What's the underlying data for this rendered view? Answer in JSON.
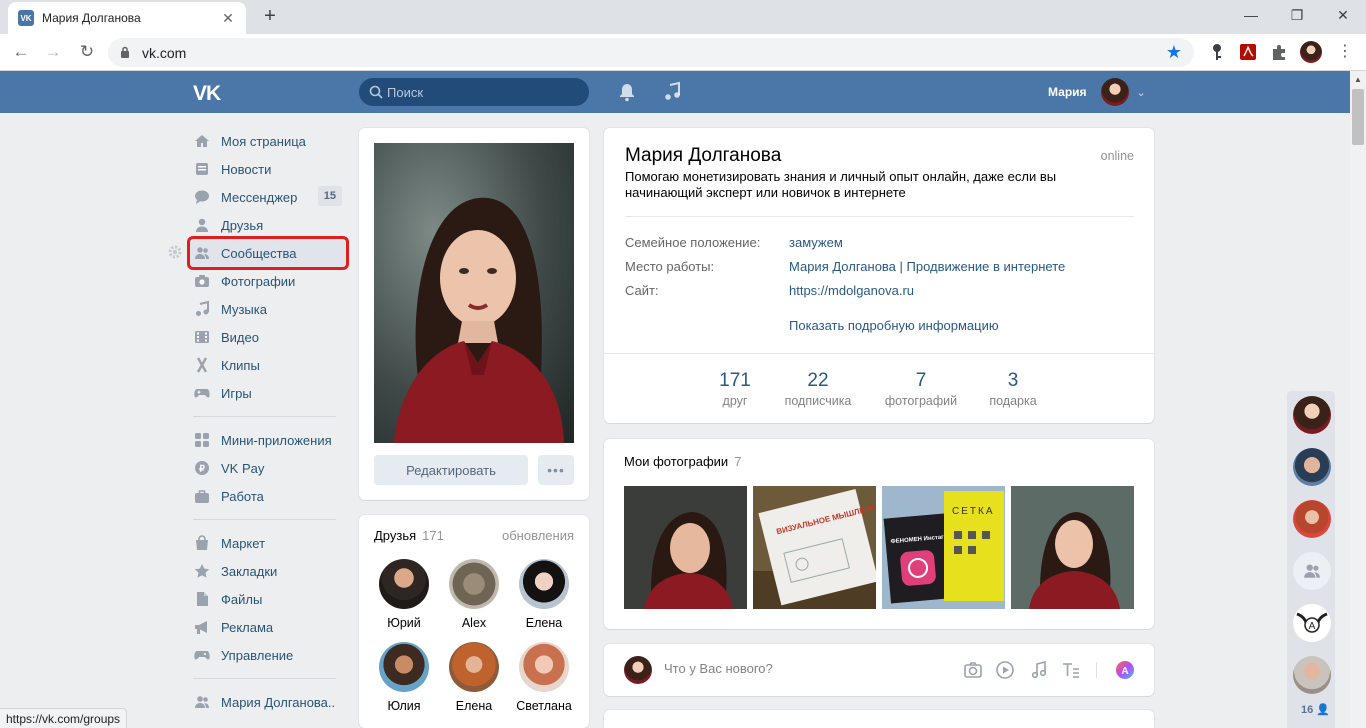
{
  "browser": {
    "tab_title": "Мария Долганова",
    "url": "vk.com",
    "status_url": "https://vk.com/groups"
  },
  "header": {
    "logo": "VK",
    "search_placeholder": "Поиск",
    "user_name": "Мария"
  },
  "menu": {
    "items": [
      {
        "label": "Моя страница",
        "icon": "home-icon"
      },
      {
        "label": "Новости",
        "icon": "news-icon"
      },
      {
        "label": "Мессенджер",
        "icon": "messenger-icon",
        "count": "15"
      },
      {
        "label": "Друзья",
        "icon": "friends-icon"
      },
      {
        "label": "Сообщества",
        "icon": "communities-icon"
      },
      {
        "label": "Фотографии",
        "icon": "photos-icon"
      },
      {
        "label": "Музыка",
        "icon": "music-icon"
      },
      {
        "label": "Видео",
        "icon": "video-icon"
      },
      {
        "label": "Клипы",
        "icon": "clips-icon"
      },
      {
        "label": "Игры",
        "icon": "games-icon"
      },
      {
        "label": "Мини-приложения",
        "icon": "apps-icon"
      },
      {
        "label": "VK Pay",
        "icon": "vkpay-icon"
      },
      {
        "label": "Работа",
        "icon": "work-icon"
      },
      {
        "label": "Маркет",
        "icon": "market-icon"
      },
      {
        "label": "Закладки",
        "icon": "bookmarks-icon"
      },
      {
        "label": "Файлы",
        "icon": "files-icon"
      },
      {
        "label": "Реклама",
        "icon": "ads-icon"
      },
      {
        "label": "Управление",
        "icon": "manage-icon"
      },
      {
        "label": "Мария Долганова..",
        "icon": "group-icon"
      }
    ],
    "active_item": "Сообщества"
  },
  "profile": {
    "edit_label": "Редактировать",
    "more_label": "•••",
    "name": "Мария Долганова",
    "online": "online",
    "status": "Помогаю монетизировать знания и личный опыт онлайн, даже если вы начинающий эксперт или новичок в интернете",
    "info": [
      {
        "label": "Семейное положение:",
        "value": "замужем"
      },
      {
        "label": "Место работы:",
        "value": "Мария Долганова | Продвижение в интернете"
      },
      {
        "label": "Сайт:",
        "value": "https://mdolganova.ru"
      }
    ],
    "show_more": "Показать подробную информацию",
    "stats": [
      {
        "num": "171",
        "label": "друг"
      },
      {
        "num": "22",
        "label": "подписчика"
      },
      {
        "num": "7",
        "label": "фотографий"
      },
      {
        "num": "3",
        "label": "подарка"
      }
    ]
  },
  "friends": {
    "title": "Друзья",
    "count": "171",
    "updates": "обновления",
    "list": [
      {
        "name": "Юрий"
      },
      {
        "name": "Alex"
      },
      {
        "name": "Елена"
      },
      {
        "name": "Юлия"
      },
      {
        "name": "Елена"
      },
      {
        "name": "Светлана"
      }
    ]
  },
  "photos": {
    "title": "Мои фотографии",
    "count": "7",
    "thumbs": [
      {
        "cover_title": ""
      },
      {
        "cover_title": "ВИЗУАЛЬНОЕ МЫШЛЕНИЕ"
      },
      {
        "cover_title": "ФЕНОМЕН Инстаграм"
      },
      {
        "cover_title": "СЕТКА"
      }
    ]
  },
  "post": {
    "placeholder": "Что у Вас нового?"
  },
  "right_bar": {
    "online_count": "16"
  },
  "colors": {
    "vk_blue": "#4a76a8",
    "link": "#2a5885",
    "highlight": "#e01e1e"
  }
}
